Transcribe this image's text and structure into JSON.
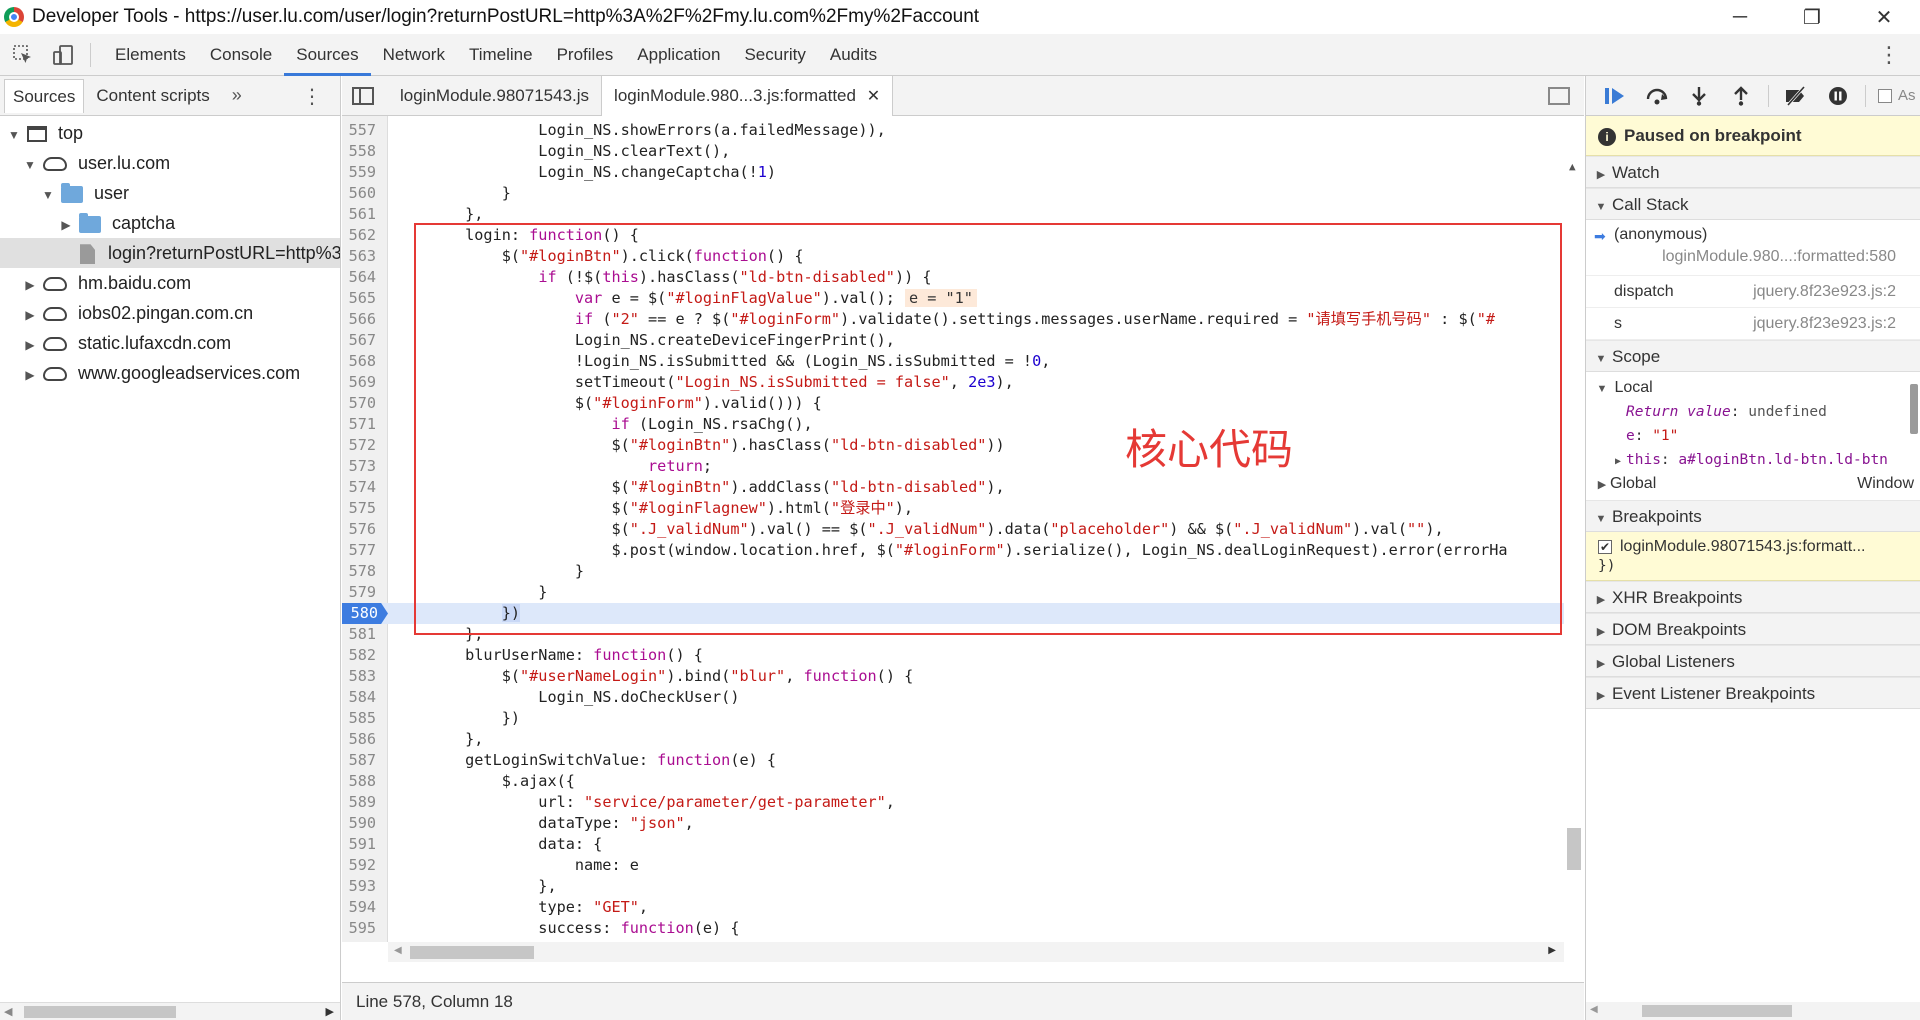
{
  "window": {
    "title": "Developer Tools - https://user.lu.com/user/login?returnPostURL=http%3A%2F%2Fmy.lu.com%2Fmy%2Faccount",
    "minimize": "─",
    "restore": "❐",
    "close": "✕"
  },
  "toolbar": {
    "tabs": [
      "Elements",
      "Console",
      "Sources",
      "Network",
      "Timeline",
      "Profiles",
      "Application",
      "Security",
      "Audits"
    ],
    "active_tab": "Sources"
  },
  "navigator": {
    "tabs": [
      "Sources",
      "Content scripts"
    ],
    "more": "»",
    "tree": [
      {
        "label": "top",
        "icon": "frame-icon",
        "expanded": true
      },
      {
        "label": "user.lu.com",
        "icon": "cloud-icon",
        "expanded": true
      },
      {
        "label": "user",
        "icon": "folder-icon",
        "expanded": true
      },
      {
        "label": "captcha",
        "icon": "folder-icon",
        "expanded": false
      },
      {
        "label": "login?returnPostURL=http%3",
        "icon": "file-icon",
        "selected": true
      },
      {
        "label": "hm.baidu.com",
        "icon": "cloud-icon",
        "expanded": false
      },
      {
        "label": "iobs02.pingan.com.cn",
        "icon": "cloud-icon",
        "expanded": false
      },
      {
        "label": "static.lufaxcdn.com",
        "icon": "cloud-icon",
        "expanded": false
      },
      {
        "label": "www.googleadservices.com",
        "icon": "cloud-icon",
        "expanded": false
      }
    ]
  },
  "editor": {
    "tabs": [
      {
        "label": "loginModule.98071543.js",
        "active": false
      },
      {
        "label": "loginModule.980...3.js:formatted",
        "active": true
      }
    ],
    "close_glyph": "✕",
    "breakpoint_line": "580",
    "annotation": "核心代码",
    "status": "Line 578, Column 18"
  },
  "debugger": {
    "paused_message": "Paused on breakpoint",
    "sections": {
      "watch": "Watch",
      "call_stack": "Call Stack",
      "scope": "Scope",
      "breakpoints": "Breakpoints",
      "xhr": "XHR Breakpoints",
      "dom": "DOM Breakpoints",
      "global_listeners": "Global Listeners",
      "event_listeners": "Event Listener Breakpoints"
    },
    "call_stack": [
      {
        "fn": "(anonymous)",
        "loc": "loginModule.980...:formatted:580"
      },
      {
        "fn": "dispatch",
        "loc": "jquery.8f23e923.js:2"
      },
      {
        "fn": "s",
        "loc": "jquery.8f23e923.js:2"
      }
    ],
    "scope": {
      "local_label": "Local",
      "return_value_key": "Return value",
      "return_value": "undefined",
      "e_key": "e",
      "e_value": "\"1\"",
      "this_key": "this",
      "this_value": "a#loginBtn.ld-btn.ld-btn",
      "global_label": "Global",
      "global_value": "Window"
    },
    "breakpoint_item": {
      "file": "loginModule.98071543.js:formatt...",
      "snippet": "})"
    },
    "async_label": "As"
  }
}
